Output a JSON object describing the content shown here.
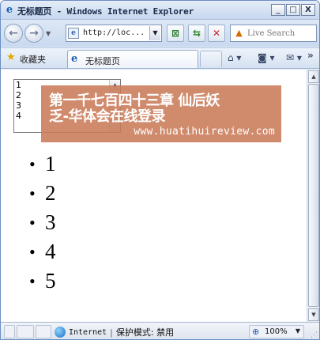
{
  "window": {
    "title": "无标题页 - Windows Internet Explorer",
    "minimize": "_",
    "maximize": "□",
    "close": "X"
  },
  "toolbar": {
    "address": "http://loc...",
    "search_placeholder": "Live Search"
  },
  "favorites": {
    "label": "收藏夹",
    "tab_title": "无标题页"
  },
  "page": {
    "listbox_items": [
      "1",
      "2",
      "3",
      "4"
    ],
    "bullet_items": [
      "1",
      "2",
      "3",
      "4",
      "5"
    ],
    "bullet_char": "•"
  },
  "watermark": {
    "line1": "第一千七百四十三章 仙后妖",
    "line2": "乏-华体会在线登录",
    "url": "www.huatihuireview.com"
  },
  "status": {
    "zone": "Internet",
    "separator": "|",
    "protected_mode": "保护模式: 禁用",
    "zoom": "100%"
  },
  "colors": {
    "chrome_blue": "#dfe8f5",
    "watermark_bg": "#c97b59"
  },
  "icons": {
    "ie_logo": "ie-logo-icon",
    "back": "back-arrow-icon",
    "forward": "forward-arrow-icon",
    "refresh": "refresh-icon",
    "stop": "stop-icon",
    "favorites": "star-icon",
    "home": "home-icon",
    "feeds": "feeds-icon",
    "mail": "mail-icon",
    "globe": "globe-icon",
    "zoom": "zoom-icon"
  }
}
